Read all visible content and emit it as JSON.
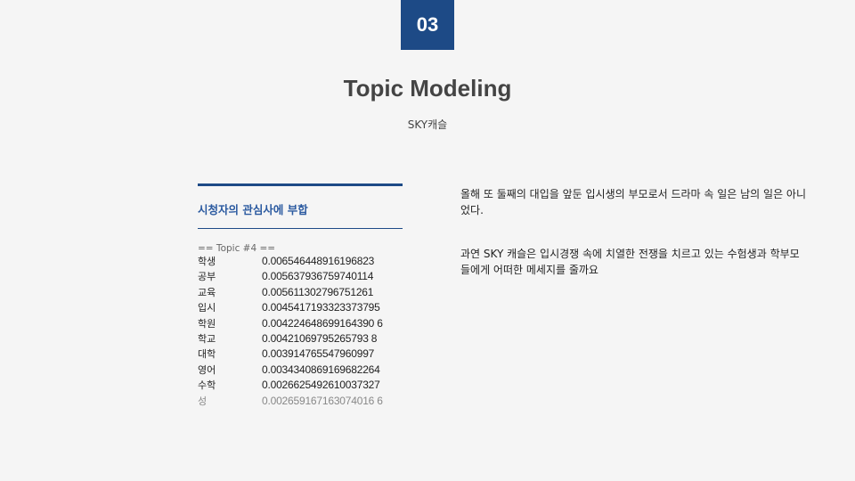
{
  "slide": {
    "number": "03",
    "title": "Topic Modeling",
    "subtitle": "SKY캐슬"
  },
  "left": {
    "heading": "시청자의 관심사에 부합",
    "topic_header": "== Topic  #4 ==",
    "rows": [
      {
        "word": "학생",
        "score": "0.006546448916196823"
      },
      {
        "word": "공부",
        "score": "0.005637936759740114"
      },
      {
        "word": "교육",
        "score": "0.005611302796751261"
      },
      {
        "word": "입시",
        "score": "0.0045417193323373795"
      },
      {
        "word": "학원",
        "score": "0.004224648699164390 6"
      },
      {
        "word": "학교",
        "score": "0.00421069795265793 8"
      },
      {
        "word": "대학",
        "score": "0.003914765547960997"
      },
      {
        "word": "영어",
        "score": "0.0034340869169682264"
      },
      {
        "word": "수학",
        "score": "0.0026625492610037327"
      },
      {
        "word": "성",
        "score": "0.002659167163074016 6"
      }
    ]
  },
  "right": {
    "paragraph_1": "올해 또 둘째의 대입을 앞둔 입시생의 부모로서 드라마 속 일은 남의 일은 아니었다.",
    "paragraph_2": "과연 SKY 캐슬은 입시경쟁 속에 치열한 전쟁을 치르고 있는 수험생과 학부모들에게 어떠한 메세지를 줄까요"
  },
  "colors": {
    "accent": "#1d4a86",
    "heading": "#2b5aa0",
    "background": "#f5f5f5"
  }
}
